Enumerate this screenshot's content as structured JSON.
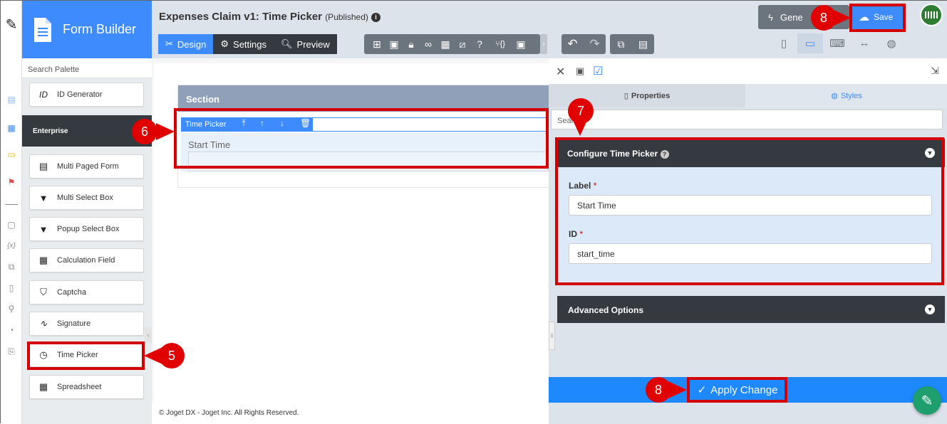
{
  "app": {
    "title": "Form Builder"
  },
  "form": {
    "title": "Expenses Claim v1: Time Picker",
    "status": "(Published)"
  },
  "tabs": [
    {
      "label": "Design"
    },
    {
      "label": "Settings"
    },
    {
      "label": "Preview"
    }
  ],
  "header": {
    "generate_label": "Gene",
    "save_label": "Save"
  },
  "palette": {
    "search_placeholder": "Search Palette",
    "top_item": "ID Generator",
    "category": "Enterprise",
    "items": [
      {
        "label": "Multi Paged Form",
        "icon": "multi-paged-form-icon"
      },
      {
        "label": "Multi Select Box",
        "icon": "dropdown-icon"
      },
      {
        "label": "Popup Select Box",
        "icon": "dropdown-icon"
      },
      {
        "label": "Calculation Field",
        "icon": "calculator-icon"
      },
      {
        "label": "Captcha",
        "icon": "shield-icon"
      },
      {
        "label": "Signature",
        "icon": "signature-icon"
      },
      {
        "label": "Time Picker",
        "icon": "clock-icon"
      },
      {
        "label": "Spreadsheet",
        "icon": "table-icon"
      }
    ]
  },
  "canvas": {
    "section_title": "Section",
    "element_label": "Time Picker",
    "field_label": "Start Time"
  },
  "footer": {
    "text": "© Joget DX - Joget Inc. All Rights Reserved."
  },
  "properties": {
    "tabs": [
      {
        "label": "Properties"
      },
      {
        "label": "Styles"
      }
    ],
    "search_placeholder": "Sear",
    "config_title": "Configure Time Picker",
    "label_field": {
      "label": "Label",
      "required": "*",
      "value": "Start Time"
    },
    "id_field": {
      "label": "ID",
      "required": "*",
      "value": "start_time"
    },
    "advanced_title": "Advanced Options",
    "apply_label": "Apply Change"
  },
  "annotations": [
    {
      "number": "5"
    },
    {
      "number": "6"
    },
    {
      "number": "7"
    },
    {
      "number": "8"
    },
    {
      "number": "8"
    }
  ],
  "colors": {
    "primary": "#3d8bfd",
    "dark": "#343a40",
    "annotation_red": "#d40000",
    "apply_blue": "#1e88ff"
  }
}
